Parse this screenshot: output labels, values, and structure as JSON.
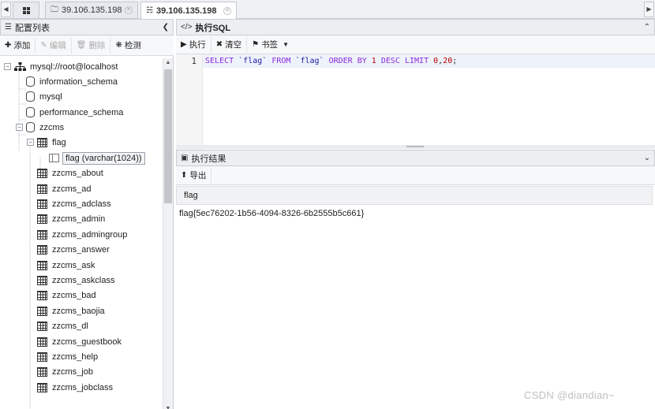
{
  "tabs": [
    {
      "icon": "folder-icon",
      "label": "39.106.135.198",
      "active": false
    },
    {
      "icon": "database-icon",
      "label": "39.106.135.198",
      "active": true
    }
  ],
  "left_panel": {
    "title": "配置列表",
    "toolbar": {
      "add": "添加",
      "edit": "编辑",
      "delete": "删除",
      "check": "检测"
    },
    "tree": {
      "root": "mysql://root@localhost",
      "databases": [
        "information_schema",
        "mysql",
        "performance_schema",
        "zzcms"
      ],
      "open_table": "flag",
      "field": "flag (varchar(1024))",
      "tables": [
        "zzcms_about",
        "zzcms_ad",
        "zzcms_adclass",
        "zzcms_admin",
        "zzcms_admingroup",
        "zzcms_answer",
        "zzcms_ask",
        "zzcms_askclass",
        "zzcms_bad",
        "zzcms_baojia",
        "zzcms_dl",
        "zzcms_guestbook",
        "zzcms_help",
        "zzcms_job",
        "zzcms_jobclass"
      ]
    }
  },
  "sql_panel": {
    "title": "执行SQL",
    "toolbar": {
      "run": "执行",
      "clear": "清空",
      "bookmark": "书签"
    },
    "line_number": "1",
    "query_tokens": [
      {
        "t": "SELECT",
        "c": "kw"
      },
      {
        "t": " ",
        "c": "plain"
      },
      {
        "t": "`flag`",
        "c": "str"
      },
      {
        "t": " ",
        "c": "plain"
      },
      {
        "t": "FROM",
        "c": "kw"
      },
      {
        "t": " ",
        "c": "plain"
      },
      {
        "t": "`flag`",
        "c": "str"
      },
      {
        "t": " ",
        "c": "plain"
      },
      {
        "t": "ORDER BY",
        "c": "kw"
      },
      {
        "t": " ",
        "c": "plain"
      },
      {
        "t": "1",
        "c": "num"
      },
      {
        "t": " ",
        "c": "plain"
      },
      {
        "t": "DESC",
        "c": "kw"
      },
      {
        "t": " ",
        "c": "plain"
      },
      {
        "t": "LIMIT",
        "c": "kw"
      },
      {
        "t": " ",
        "c": "plain"
      },
      {
        "t": "0",
        "c": "num"
      },
      {
        "t": ",",
        "c": "plain"
      },
      {
        "t": "20",
        "c": "num"
      },
      {
        "t": ";",
        "c": "plain"
      }
    ]
  },
  "result_panel": {
    "title": "执行结果",
    "toolbar": {
      "export": "导出"
    },
    "columns": [
      "flag"
    ],
    "rows": [
      [
        "flag{5ec76202-1b56-4094-8326-6b2555b5c661}"
      ]
    ]
  },
  "watermark": "CSDN @diandian~"
}
